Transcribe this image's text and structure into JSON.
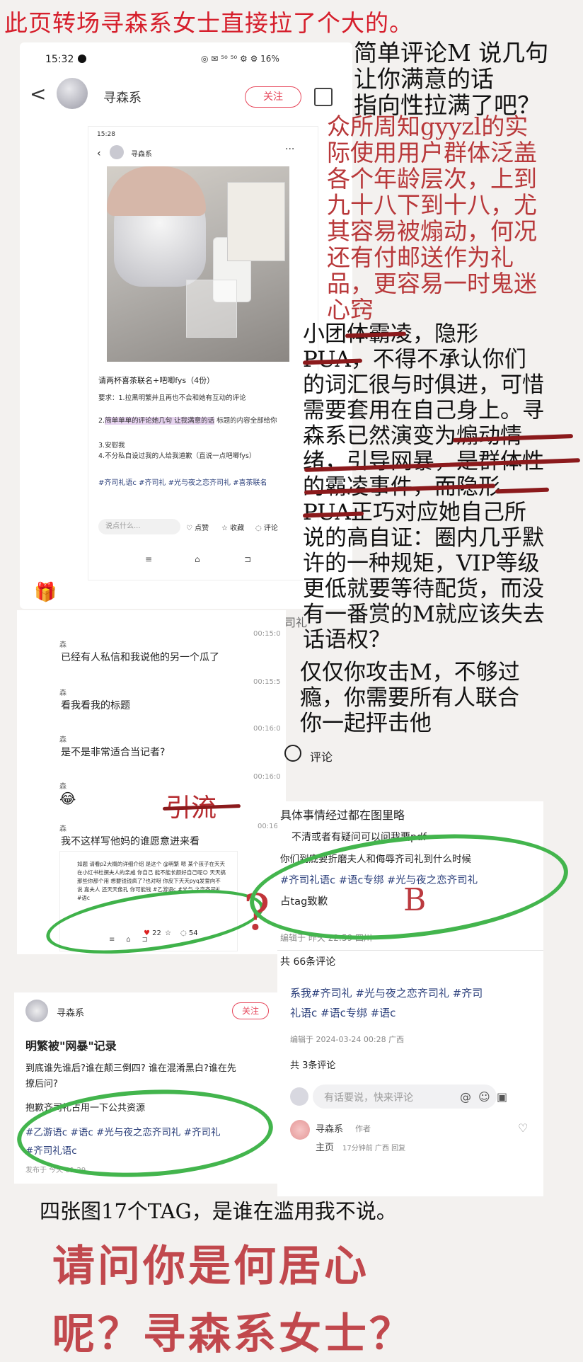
{
  "top_title": "此页转场寻森系女士直接拉了个大的。",
  "phone1": {
    "time": "15:32",
    "status_icons": "◎ ✉ ⁵⁰ ⁵⁰ ⚙ ⚙ 16%",
    "back": "<",
    "author": "寻森系",
    "follow": "关注",
    "inner_time": "15:28",
    "inner_author": "寻森系",
    "post_title": "请两杯喜茶联名+吧唧fys（4份）",
    "post_req": "要求：1.拉黑明繁并且再也不会和她有互动的评论",
    "post_line2a": "2.",
    "post_line2_highlight": "简单单单的评论她几句 让我满意的话",
    "post_line2b": " 标题的内容全部给你",
    "post_line3": "3.安慰我",
    "post_line4": "4.不分私自设过我的人给我道歉（直说一点吧唧fys）",
    "post_tags": "#齐司礼语c #齐司礼 #光与夜之恋齐司礼 #喜茶联名",
    "comment_placeholder": "说点什么...",
    "like": "点赞",
    "collect": "收藏",
    "comment": "评论"
  },
  "right_text1": [
    "简单评论M 说几句",
    "让你满意的话",
    "指向性拉满了吧？"
  ],
  "right_text2": [
    "众所周知gyyzl的实",
    "际使用用户群体泛盖",
    "各个年龄层次，上到",
    "九十八下到十八，尤",
    "其容易被煽动，何况",
    "还有付邮送作为礼",
    "品，更容易一时鬼迷",
    "心窍"
  ],
  "right_text3": [
    "小团体霸凌，隐形",
    "PUA，不得不承认你们",
    "的词汇很与时俱进，可惜",
    "需要套用在自己身上。寻",
    "森系已然演变为煽动情",
    "绪，引导网暴，是群体性",
    "的霸凌事件，而隐形",
    "PUA正巧对应她自己所",
    "说的高自证：圈内几乎默",
    "许的一种规矩，VIP等级",
    "更低就要等待配货，而没",
    "有一番赏的M就应该失去",
    "话语权？"
  ],
  "right_text4": [
    "仅仅你攻击M，不够过",
    "瘾，你需要所有人联合",
    "你一起抨击他"
  ],
  "chat": {
    "gift_icon": "🎁",
    "overlay_label": "齐司礼",
    "rows": [
      {
        "text": "已经有人私信和我说他的另一个瓜了",
        "time": "00:15:0"
      },
      {
        "text": "看我看我的标题",
        "time": "00:15:5"
      },
      {
        "text": "是不是非常适合当记者?",
        "time": "00:16:0"
      }
    ],
    "emoji": "😂",
    "emoji_time": "00:16:0",
    "last_text": "我不这样写他妈的谁愿意进来看",
    "last_time": "00:16:",
    "comment_label": "评论",
    "yinliu": "引流",
    "nested_text": "如题 请看p2大概的详细介绍 是这个 @明繁 嗯 某个孩子在天天在小红书杜撰夫人的亲戚 你自己 能不能长颜好自己呢😑 天天搞那些你那个用 想要钱钱疯了?也对呀 你皮下天天pyq发誓向不说 嘉夫人 还天天像孔 你可能钱 #乙游语c #光与 之恋齐司礼 #语c",
    "nested_likes": "22",
    "nested_comments": "54",
    "question_mark": "?"
  },
  "right_card": {
    "line1": "具体事情经过都在图里略",
    "line2": "不清或者有疑问可以问我要pdf",
    "line3": "你们到底要折磨夫人和侮辱齐司礼到什么时候",
    "line4": "#齐司礼语c #语c专绑 #光与夜之恋齐司礼",
    "line5": "占tag致歉",
    "mark_b": "B",
    "edit": "编辑于 昨天 22:59 四川",
    "total": "共 66条评论",
    "line6": "系我#齐司礼 #光与夜之恋齐司礼 #齐司",
    "line7": "礼语c #语c专绑 #语c",
    "edit2": "编辑于 2024-03-24 00:28 广西",
    "comments3": "共 3条评论",
    "reply_placeholder": "有话要说，快来评论",
    "commenter": "寻森系",
    "author_tag": "作者",
    "reply_preview": "主页",
    "reply_time": "17分钟前 广西 回复"
  },
  "left_card": {
    "author": "寻森系",
    "follow": "关注",
    "title": "明繁被\"网暴\"记录",
    "body1": "到底谁先谁后?谁在颠三倒四? 谁在混淆黑白?谁在先",
    "body2": "撩后问?",
    "body3": "抱歉齐司礼占用一下公共资源",
    "tags1": "#乙游语c #语c #光与夜之恋齐司礼 #齐司礼",
    "tags2": "#齐司礼语c",
    "footer": "发布于 今天 01:29"
  },
  "bottom_statement": "四张图17个TAG，是谁在滥用我不说。",
  "big_question": [
    "请问你是何居心",
    "呢？寻森系女士？"
  ]
}
